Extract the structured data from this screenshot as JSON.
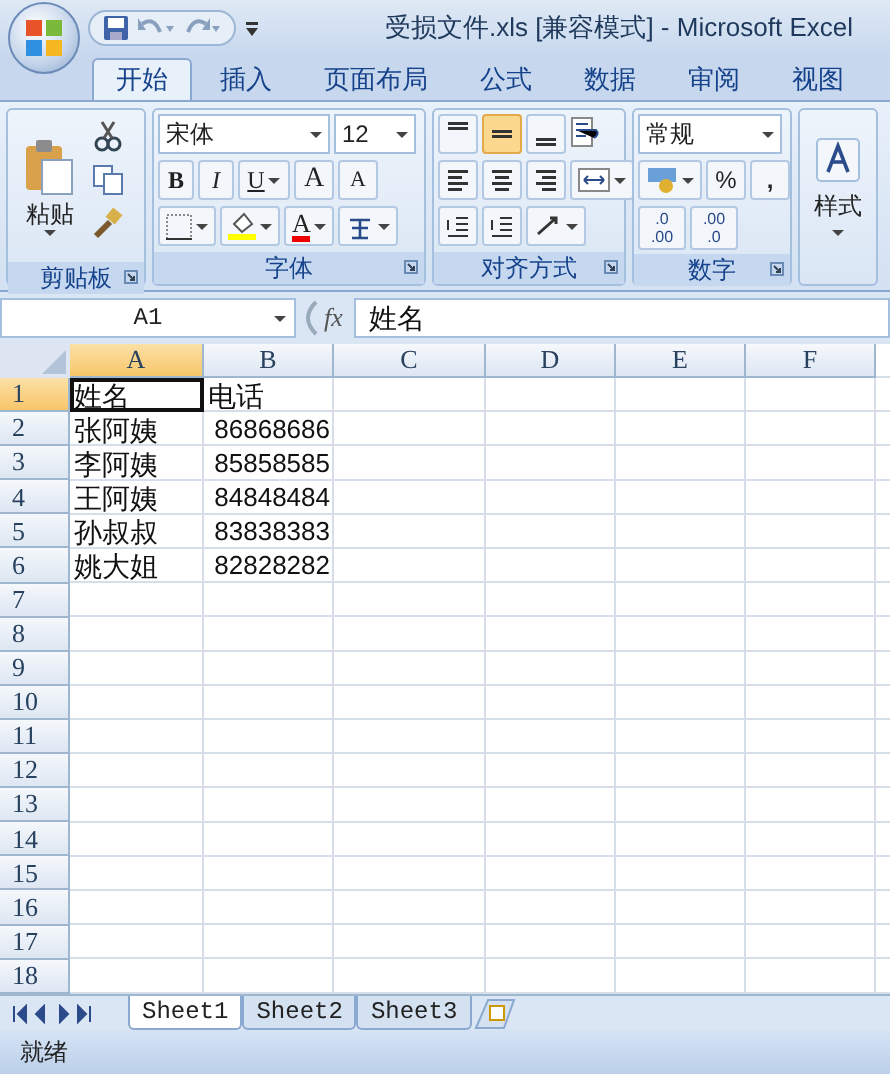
{
  "window": {
    "title": "受损文件.xls  [兼容模式] - Microsoft Excel"
  },
  "tabs": [
    {
      "label": "开始",
      "selected": true
    },
    {
      "label": "插入",
      "selected": false
    },
    {
      "label": "页面布局",
      "selected": false
    },
    {
      "label": "公式",
      "selected": false
    },
    {
      "label": "数据",
      "selected": false
    },
    {
      "label": "审阅",
      "selected": false
    },
    {
      "label": "视图",
      "selected": false
    }
  ],
  "ribbon": {
    "clipboard": {
      "label": "剪贴板",
      "paste": "粘贴"
    },
    "font": {
      "label": "字体",
      "font_name": "宋体",
      "font_size": "12",
      "bold": "B",
      "italic": "I",
      "underline": "U",
      "grow": "A",
      "shrink": "A",
      "font_color": "A"
    },
    "alignment": {
      "label": "对齐方式",
      "vertical": [
        {
          "selected": false
        },
        {
          "selected": true
        },
        {
          "selected": false
        }
      ]
    },
    "number": {
      "label": "数字",
      "format": "常规",
      "percent": "%",
      "comma": ",",
      "increase_decimal": [
        ".0",
        ".00"
      ],
      "decrease_decimal": [
        ".00",
        ".0"
      ]
    },
    "styles": {
      "label": "样式"
    }
  },
  "formula_bar": {
    "name_box": "A1",
    "fx": "fx",
    "content": "姓名"
  },
  "sheet": {
    "columns": [
      {
        "label": "A",
        "selected": true
      },
      {
        "label": "B",
        "selected": false
      },
      {
        "label": "C",
        "selected": false
      },
      {
        "label": "D",
        "selected": false
      },
      {
        "label": "E",
        "selected": false
      },
      {
        "label": "F",
        "selected": false
      }
    ],
    "rows": [
      {
        "number": "1",
        "selected": true,
        "cells": [
          "姓名",
          "电话"
        ]
      },
      {
        "number": "2",
        "selected": false,
        "cells": [
          "张阿姨",
          "86868686"
        ]
      },
      {
        "number": "3",
        "selected": false,
        "cells": [
          "李阿姨",
          "85858585"
        ]
      },
      {
        "number": "4",
        "selected": false,
        "cells": [
          "王阿姨",
          "84848484"
        ]
      },
      {
        "number": "5",
        "selected": false,
        "cells": [
          "孙叔叔",
          "83838383"
        ]
      },
      {
        "number": "6",
        "selected": false,
        "cells": [
          "姚大姐",
          "82828282"
        ]
      },
      {
        "number": "7",
        "selected": false,
        "cells": []
      },
      {
        "number": "8",
        "selected": false,
        "cells": []
      },
      {
        "number": "9",
        "selected": false,
        "cells": []
      },
      {
        "number": "10",
        "selected": false,
        "cells": []
      },
      {
        "number": "11",
        "selected": false,
        "cells": []
      },
      {
        "number": "12",
        "selected": false,
        "cells": []
      },
      {
        "number": "13",
        "selected": false,
        "cells": []
      },
      {
        "number": "14",
        "selected": false,
        "cells": []
      },
      {
        "number": "15",
        "selected": false,
        "cells": []
      },
      {
        "number": "16",
        "selected": false,
        "cells": []
      },
      {
        "number": "17",
        "selected": false,
        "cells": []
      },
      {
        "number": "18",
        "selected": false,
        "cells": []
      }
    ]
  },
  "sheet_tabs": [
    {
      "label": "Sheet1",
      "selected": true
    },
    {
      "label": "Sheet2",
      "selected": false
    },
    {
      "label": "Sheet3",
      "selected": false
    }
  ],
  "status_bar": {
    "text": "就绪"
  }
}
